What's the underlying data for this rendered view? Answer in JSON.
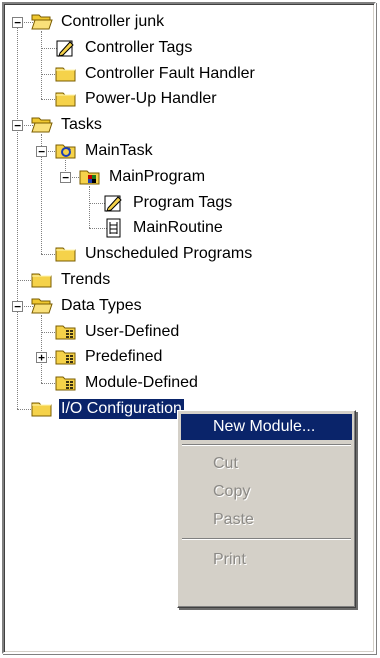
{
  "tree": {
    "items": [
      {
        "label": "Controller junk",
        "icon": "folder-open-icon",
        "level": 0,
        "expander": "minus"
      },
      {
        "label": "Controller Tags",
        "icon": "tags-pencil-icon",
        "level": 1
      },
      {
        "label": "Controller Fault Handler",
        "icon": "folder-icon",
        "level": 1
      },
      {
        "label": "Power-Up Handler",
        "icon": "folder-icon",
        "level": 1
      },
      {
        "label": "Tasks",
        "icon": "folder-open-icon",
        "level": 0,
        "expander": "minus"
      },
      {
        "label": "MainTask",
        "icon": "task-icon",
        "level": 1,
        "expander": "minus"
      },
      {
        "label": "MainProgram",
        "icon": "program-icon",
        "level": 2,
        "expander": "minus"
      },
      {
        "label": "Program Tags",
        "icon": "tags-pencil-icon",
        "level": 3
      },
      {
        "label": "MainRoutine",
        "icon": "routine-icon",
        "level": 3
      },
      {
        "label": "Unscheduled Programs",
        "icon": "folder-icon",
        "level": 1
      },
      {
        "label": "Trends",
        "icon": "folder-icon",
        "level": 0
      },
      {
        "label": "Data Types",
        "icon": "folder-open-icon",
        "level": 0,
        "expander": "minus"
      },
      {
        "label": "User-Defined",
        "icon": "datatype-folder-icon",
        "level": 1
      },
      {
        "label": "Predefined",
        "icon": "datatype-folder-icon",
        "level": 1,
        "expander": "plus"
      },
      {
        "label": "Module-Defined",
        "icon": "datatype-folder-icon",
        "level": 1
      },
      {
        "label": "I/O Configuration",
        "icon": "folder-icon",
        "level": 0,
        "selected": true
      }
    ]
  },
  "context_menu": {
    "items": [
      {
        "label": "New Module...",
        "state": "highlighted"
      },
      {
        "label": "Cut",
        "state": "disabled"
      },
      {
        "label": "Copy",
        "state": "disabled"
      },
      {
        "label": "Paste",
        "state": "disabled"
      },
      {
        "label": "Print",
        "state": "disabled"
      }
    ]
  },
  "colors": {
    "selection": "#0a246a",
    "menu_face": "#d4d0c8",
    "folder_yellow": "#f5d24a",
    "disabled_text": "#8c8a86"
  }
}
